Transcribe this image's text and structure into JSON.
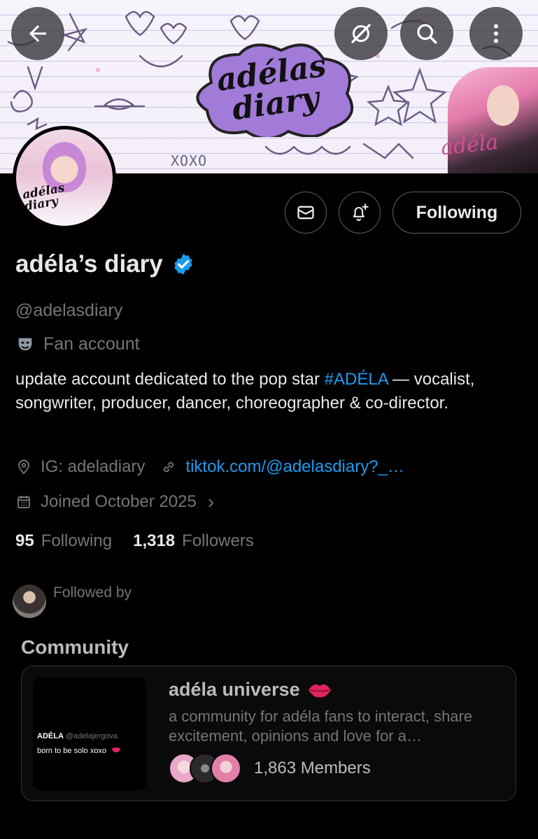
{
  "banner": {
    "logo_text": "adélas\ndiary",
    "corner_word": "adéla",
    "xoxo": "XOXO"
  },
  "nav": {
    "back_icon": "arrow-left-icon",
    "grok_icon": "slash-circle-icon",
    "search_icon": "search-icon",
    "more_icon": "more-vertical-icon"
  },
  "avatar": {
    "text": "adélas\ndiary"
  },
  "actions": {
    "message_icon": "envelope-icon",
    "notify_icon": "bell-plus-icon",
    "following_label": "Following"
  },
  "profile": {
    "display_name": "adéla’s diary",
    "verified_color": "#1d9bf0",
    "handle": "@adelasdiary",
    "label": "Fan account",
    "bio_prefix": "update account dedicated to the pop star ",
    "bio_hashtag": "#ADÉLA",
    "bio_suffix": " — vocalist, songwriter, producer, dancer, choreographer & co-director.",
    "location": "IG: adeladiary",
    "website": "tiktok.com/@adelasdiary?_…",
    "joined": "Joined October 2025",
    "chevron": "›"
  },
  "stats": {
    "following_count": "95",
    "following_label": "Following",
    "followers_count": "1,318",
    "followers_label": "Followers"
  },
  "followed_by": {
    "label": "Followed by"
  },
  "community": {
    "section_title": "Community",
    "thumb_name": "ADÉLA",
    "thumb_handle": "@adelajergova",
    "thumb_caption": "born to be solo xoxo",
    "name": "adéla universe",
    "description": "a community for adéla fans to interact, share excitement, opinions and love for a…",
    "members": "1,863 Members"
  },
  "colors": {
    "background": "#000000",
    "link": "#1d9bf0",
    "secondary_text": "#71767b",
    "border": "#536471",
    "lips": "#e0245e"
  }
}
